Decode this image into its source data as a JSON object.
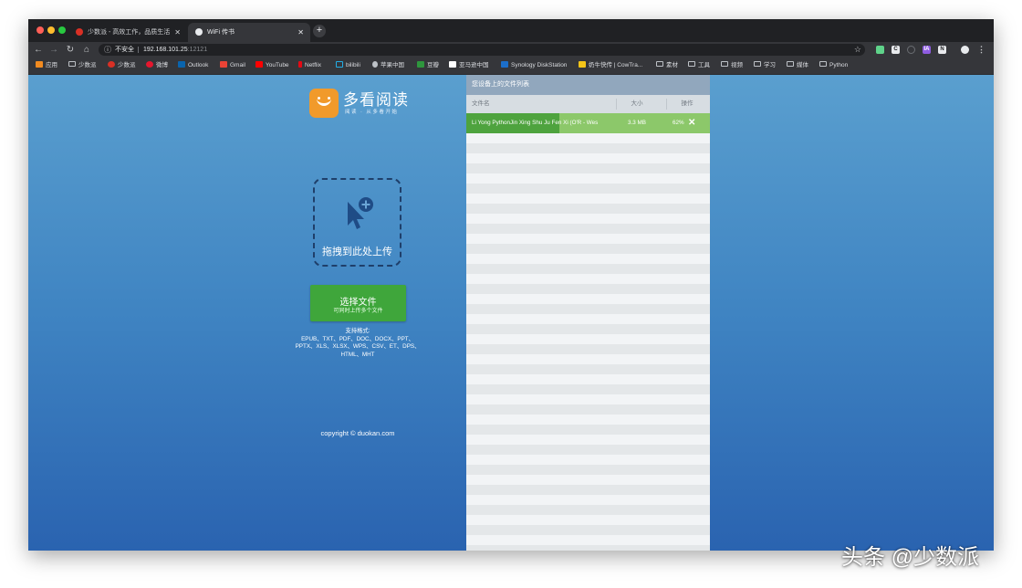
{
  "browser": {
    "tabs": [
      {
        "title": "少数派 - 高效工作，品质生活",
        "favicon_color": "#d93025"
      },
      {
        "title": "WiFi 传书",
        "favicon_color": "#e8eaed"
      }
    ],
    "address": {
      "security": "不安全",
      "host": "192.168.101.25",
      "port": ":12121"
    },
    "bookmarks": [
      {
        "label": "应用",
        "icon": "apps-grid-icon",
        "color": "#f28b20"
      },
      {
        "label": "少数派",
        "icon": "folder-icon",
        "color": ""
      },
      {
        "label": "少数派",
        "icon": "sspai-icon",
        "color": "#d93025"
      },
      {
        "label": "微博",
        "icon": "weibo-icon",
        "color": "#e6162d"
      },
      {
        "label": "Outlook",
        "icon": "outlook-icon",
        "color": "#0a64ad"
      },
      {
        "label": "Gmail",
        "icon": "gmail-icon",
        "color": "#ea4335"
      },
      {
        "label": "YouTube",
        "icon": "youtube-icon",
        "color": "#ff0000"
      },
      {
        "label": "Netflix",
        "icon": "netflix-icon",
        "color": "#e50914"
      },
      {
        "label": "bilibili",
        "icon": "bilibili-icon",
        "color": "#23ade5"
      },
      {
        "label": "苹果中国",
        "icon": "apple-icon",
        "color": "#bdc1c6"
      },
      {
        "label": "豆瓣",
        "icon": "douban-icon",
        "color": "#2e963d"
      },
      {
        "label": "亚马逊中国",
        "icon": "amazon-icon",
        "color": "#ffffff"
      },
      {
        "label": "Synology DiskStation",
        "icon": "synology-icon",
        "color": "#1c6ec9"
      },
      {
        "label": "奶牛快传 | CowTra...",
        "icon": "cowtransfer-icon",
        "color": "#f5c518"
      },
      {
        "label": "素材",
        "icon": "folder-icon",
        "color": ""
      },
      {
        "label": "工具",
        "icon": "folder-icon",
        "color": ""
      },
      {
        "label": "视频",
        "icon": "folder-icon",
        "color": ""
      },
      {
        "label": "学习",
        "icon": "folder-icon",
        "color": ""
      },
      {
        "label": "媒体",
        "icon": "folder-icon",
        "color": ""
      },
      {
        "label": "Python",
        "icon": "folder-icon",
        "color": ""
      }
    ]
  },
  "page": {
    "logo_title": "多看阅读",
    "logo_subtitle": "阅读 · 从多看开始",
    "dropzone_text": "拖拽到此处上传",
    "upload_button": {
      "label": "选择文件",
      "sublabel": "可同时上传多个文件"
    },
    "formats": {
      "heading": "支持格式:",
      "line1": "EPUB、TXT、PDF、DOC、DOCX、PPT、",
      "line2": "PPTX、XLS、XLSX、WPS、CSV、ET、DPS、",
      "line3": "HTML、MHT"
    },
    "copyright": "copyright © duokan.com",
    "accent_color": "#f19a2b",
    "button_color": "#3fa63b"
  },
  "file_panel": {
    "title": "您设备上的文件列表",
    "columns": {
      "name": "文件名",
      "size": "大小",
      "action": "操作"
    },
    "files": [
      {
        "name": "Li Yong PythonJin Xing Shu Ju Fen Xi (O'R - Wes",
        "size": "3.3 MB",
        "progress_label": "62%",
        "progress": 0.62
      }
    ]
  },
  "watermark": "头条 @少数派"
}
